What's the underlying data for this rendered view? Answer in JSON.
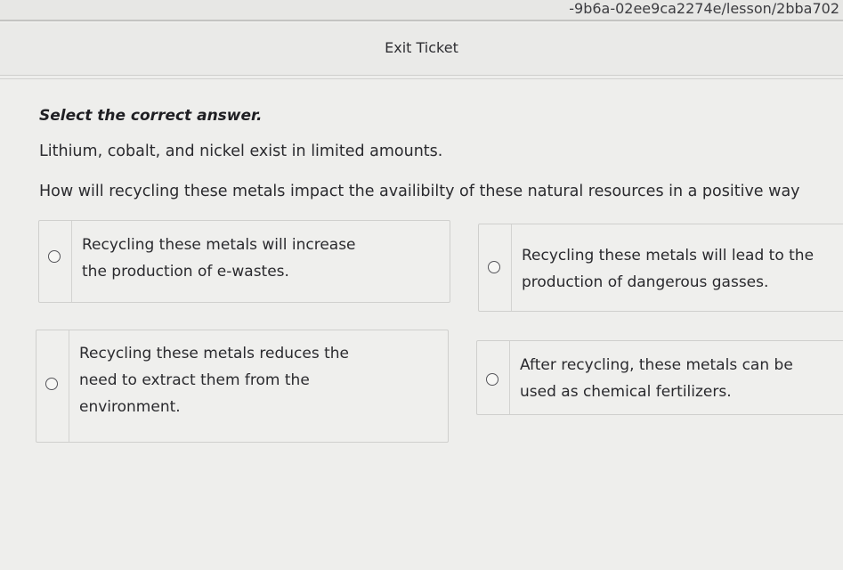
{
  "browser": {
    "url_fragment": "-9b6a-02ee9ca2274e/lesson/2bba702"
  },
  "header": {
    "title": "Exit Ticket"
  },
  "question": {
    "instruction": "Select the correct answer.",
    "line_1": "Lithium, cobalt, and nickel exist in limited amounts.",
    "line_2": "How will recycling these metals impact the availibilty of these natural resources in a positive way"
  },
  "options": [
    {
      "label": "Recycling these metals will increase\nthe production of e-wastes.",
      "selected": false
    },
    {
      "label": "Recycling these metals will lead to the\nproduction of dangerous gasses.",
      "selected": false
    },
    {
      "label": "Recycling these metals reduces the\nneed to extract them from the\nenvironment.",
      "selected": false
    },
    {
      "label": "After recycling, these metals can be\nused as chemical fertilizers.",
      "selected": false
    }
  ]
}
